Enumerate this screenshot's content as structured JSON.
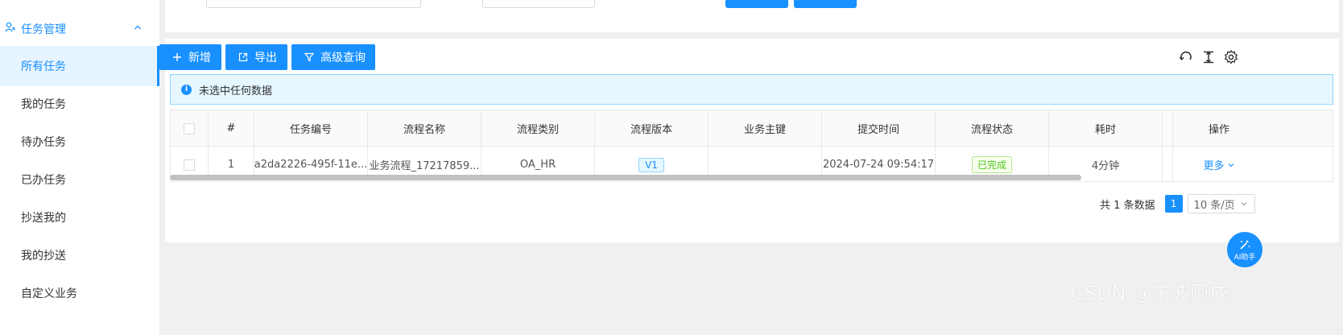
{
  "sidebar": {
    "group_title": "任务管理",
    "items": [
      {
        "label": "所有任务",
        "active": true
      },
      {
        "label": "我的任务",
        "active": false
      },
      {
        "label": "待办任务",
        "active": false
      },
      {
        "label": "已办任务",
        "active": false
      },
      {
        "label": "抄送我的",
        "active": false
      },
      {
        "label": "我的抄送",
        "active": false
      },
      {
        "label": "自定义业务",
        "active": false
      }
    ]
  },
  "toolbar": {
    "add_label": "新增",
    "export_label": "导出",
    "advanced_query_label": "高级查询",
    "icons": [
      "refresh-icon",
      "column-height-icon",
      "settings-icon"
    ]
  },
  "alert": {
    "text": "未选中任何数据"
  },
  "table": {
    "columns": [
      "#",
      "任务编号",
      "流程名称",
      "流程类别",
      "流程版本",
      "业务主键",
      "提交时间",
      "流程状态",
      "耗时",
      "操作"
    ],
    "rows": [
      {
        "index": "1",
        "task_no": "a2da2226-495f-11e...",
        "flow_name": "业务流程_17217859...",
        "category": "OA_HR",
        "version": "V1",
        "business_key": "",
        "submit_time": "2024-07-24 09:54:17",
        "status": "已完成",
        "duration": "4分钟",
        "action": "更多"
      }
    ]
  },
  "pager": {
    "total_text": "共 1 条数据",
    "current_page": "1",
    "page_size": "10 条/页"
  },
  "ai_button": {
    "label": "AI助手"
  },
  "watermark": "CSDN @宁波阿成",
  "colors": {
    "primary": "#1890ff",
    "success": "#52c41a",
    "page_bg": "#f0f0f0"
  }
}
